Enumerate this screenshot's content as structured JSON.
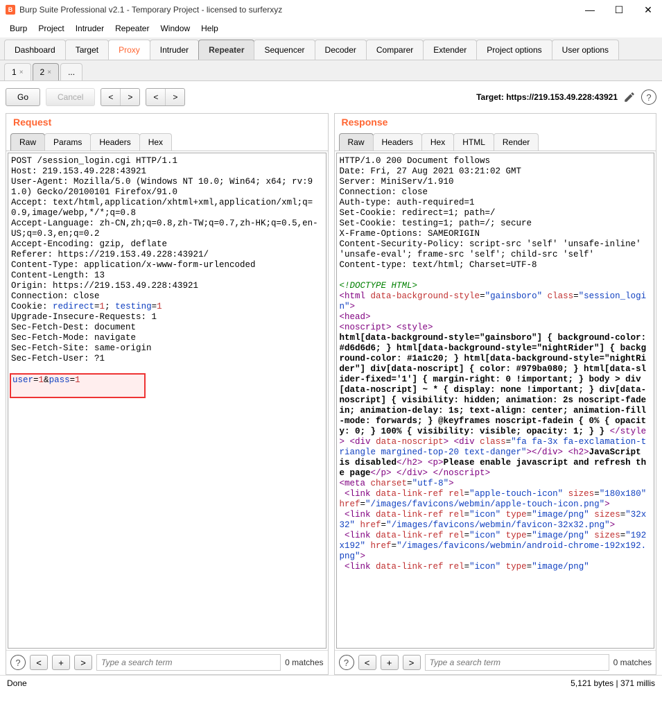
{
  "titlebar": {
    "app_icon_letter": "B",
    "title": "Burp Suite Professional v2.1 - Temporary Project - licensed to surferxyz"
  },
  "menu": [
    "Burp",
    "Project",
    "Intruder",
    "Repeater",
    "Window",
    "Help"
  ],
  "main_tabs": [
    "Dashboard",
    "Target",
    "Proxy",
    "Intruder",
    "Repeater",
    "Sequencer",
    "Decoder",
    "Comparer",
    "Extender",
    "Project options",
    "User options"
  ],
  "main_tabs_active": "Repeater",
  "sub_tabs": [
    {
      "label": "1",
      "active": false
    },
    {
      "label": "2",
      "active": true
    },
    {
      "label": "...",
      "active": false,
      "no_close": true
    }
  ],
  "toolbar": {
    "go": "Go",
    "cancel": "Cancel",
    "prev": "<",
    "next": ">",
    "prev2": "<",
    "next2": ">",
    "target_label": "Target: https://219.153.49.228:43921",
    "help": "?"
  },
  "request": {
    "title": "Request",
    "tabs": [
      "Raw",
      "Params",
      "Headers",
      "Hex"
    ],
    "active_tab": "Raw",
    "lines_pre": "POST /session_login.cgi HTTP/1.1\nHost: 219.153.49.228:43921\nUser-Agent: Mozilla/5.0 (Windows NT 10.0; Win64; x64; rv:91.0) Gecko/20100101 Firefox/91.0\nAccept: text/html,application/xhtml+xml,application/xml;q=0.9,image/webp,*/*;q=0.8\nAccept-Language: zh-CN,zh;q=0.8,zh-TW;q=0.7,zh-HK;q=0.5,en-US;q=0.3,en;q=0.2\nAccept-Encoding: gzip, deflate\nReferer: https://219.153.49.228:43921/\nContent-Type: application/x-www-form-urlencoded\nContent-Length: 13\nOrigin: https://219.153.49.228:43921\nConnection: close\nCookie: ",
    "cookie_1k": "redirect",
    "cookie_1v": "1",
    "cookie_2k": "testing",
    "cookie_2v": "1",
    "lines_post_cookie": "Upgrade-Insecure-Requests: 1\nSec-Fetch-Dest: document\nSec-Fetch-Mode: navigate\nSec-Fetch-Site: same-origin\nSec-Fetch-User: ?1\n",
    "body_k1": "user",
    "body_v1": "1",
    "body_amp": "&",
    "body_k2": "pass",
    "body_v2": "1"
  },
  "response": {
    "title": "Response",
    "tabs": [
      "Raw",
      "Headers",
      "Hex",
      "HTML",
      "Render"
    ],
    "active_tab": "Raw",
    "headers": "HTTP/1.0 200 Document follows\nDate: Fri, 27 Aug 2021 03:21:02 GMT\nServer: MiniServ/1.910\nConnection: close\nAuth-type: auth-required=1\nSet-Cookie: redirect=1; path=/\nSet-Cookie: testing=1; path=/; secure\nX-Frame-Options: SAMEORIGIN\nContent-Security-Policy: script-src 'self' 'unsafe-inline' 'unsafe-eval'; frame-src 'self'; child-src 'self'\nContent-type: text/html; Charset=UTF-8\n"
  },
  "search": {
    "placeholder": "Type a search term",
    "matches": "0 matches"
  },
  "status": {
    "left": "Done",
    "right": "5,121 bytes | 371 millis"
  }
}
